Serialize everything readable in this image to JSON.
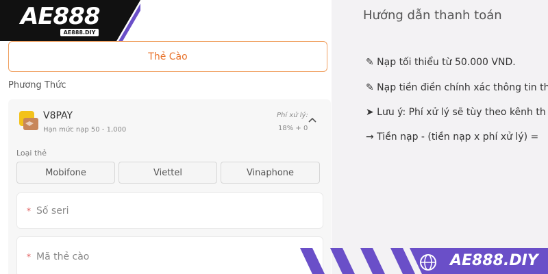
{
  "logo": {
    "text": "AE888",
    "subtext": "AE888.DIY"
  },
  "tabs": {
    "active_label": "Thẻ Cào"
  },
  "method": {
    "section_label": "Phương Thức",
    "provider_name": "V8PAY",
    "limit_text": "Hạn mức nạp 50 - 1,000",
    "fee_label": "Phí xử lý:",
    "fee_value": "18% + 0",
    "card_type_label": "Loại thẻ",
    "networks": [
      "Mobifone",
      "Viettel",
      "Vinaphone"
    ],
    "fields": [
      {
        "required_mark": "*",
        "placeholder": "Số seri"
      },
      {
        "required_mark": "*",
        "placeholder": "Mã thẻ cào"
      }
    ]
  },
  "guide": {
    "title": "Hướng dẫn thanh toán",
    "lines": [
      "✎ Nạp tối thiểu từ 50.000 VND.",
      "✎ Nạp tiền điền chính xác thông tin th",
      "➤ Lưu ý: Phí xử lý sẽ tùy theo kênh th",
      "→ Tiền nạp - (tiền nạp x phí xử lý) = "
    ]
  },
  "banner": {
    "text": "AE888.DIY"
  },
  "colors": {
    "accent": "#e8732c",
    "banner": "#6a4fc8",
    "logo_bg": "#111111"
  },
  "icons": {
    "provider": "v8pay-icon",
    "expand": "chevron-up-icon",
    "web": "globe-icon"
  }
}
